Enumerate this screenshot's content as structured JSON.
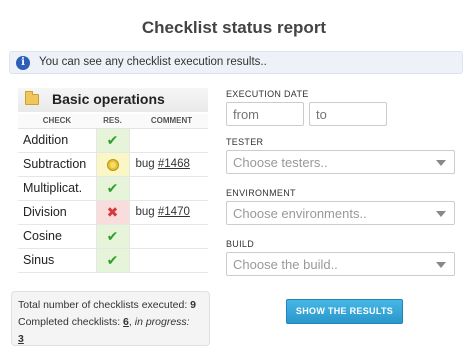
{
  "page": {
    "title": "Checklist status report"
  },
  "info": {
    "icon": "info-icon",
    "text": "You can see any checklist execution results.."
  },
  "checklist": {
    "title": "Basic operations",
    "columns": [
      "CHECK",
      "RES.",
      "COMMENT"
    ],
    "rows": [
      {
        "check": "Addition",
        "result": "pass",
        "mark": "✔",
        "comment_prefix": "",
        "bug": ""
      },
      {
        "check": "Subtraction",
        "result": "warn",
        "mark": "",
        "comment_prefix": "bug ",
        "bug": "#1468"
      },
      {
        "check": "Multiplicat.",
        "result": "pass",
        "mark": "✔",
        "comment_prefix": "",
        "bug": ""
      },
      {
        "check": "Division",
        "result": "fail",
        "mark": "✖",
        "comment_prefix": "bug ",
        "bug": "#1470"
      },
      {
        "check": "Cosine",
        "result": "pass",
        "mark": "✔",
        "comment_prefix": "",
        "bug": ""
      },
      {
        "check": "Sinus",
        "result": "pass",
        "mark": "✔",
        "comment_prefix": "",
        "bug": ""
      }
    ],
    "colors": {
      "pass": "#e6f5d9",
      "warn": "#fbf6c5",
      "fail": "#f9dcdc"
    }
  },
  "summary": {
    "total_label": "Total number of checklists executed: ",
    "total_value": "9",
    "completed_label": "Completed checklists: ",
    "completed_value": "6",
    "sep": ", ",
    "in_progress_label": "in progress: ",
    "in_progress_value": "3"
  },
  "filters": {
    "execution_date": {
      "label": "EXECUTION DATE",
      "from_placeholder": "from",
      "to_placeholder": "to"
    },
    "tester": {
      "label": "TESTER",
      "value": "Choose testers.."
    },
    "environment": {
      "label": "ENVIRONMENT",
      "value": "Choose environments.."
    },
    "build": {
      "label": "BUILD",
      "value": "Choose the build.."
    }
  },
  "button": {
    "label": "SHOW THE RESULTS",
    "color": "#2b97cc"
  }
}
